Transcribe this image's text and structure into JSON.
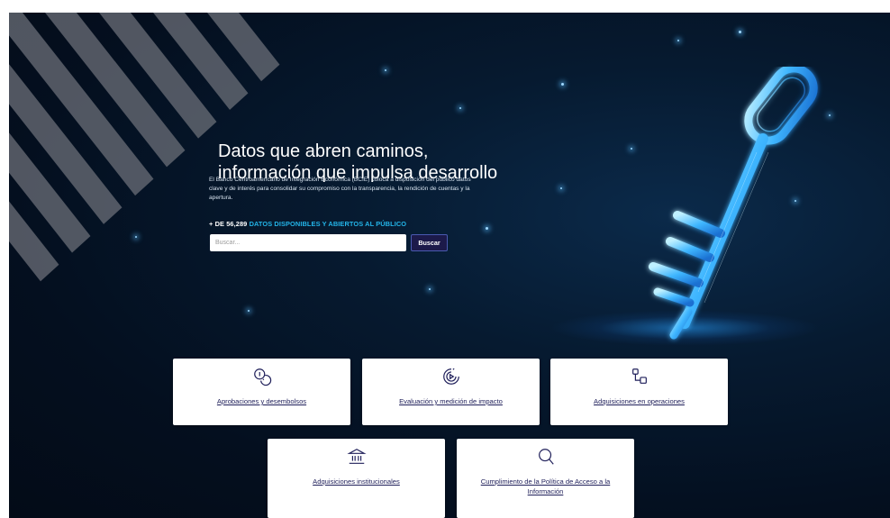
{
  "hero": {
    "headline_line1": "Datos que abren caminos,",
    "headline_line2": "información que impulsa desarrollo",
    "description": "El Banco Centroamericano de Integración Económica (BCIE) coloca a disposición del público datos clave y de interés para consolidar su compromiso con la transparencia, la rendición de cuentas y la apertura.",
    "counter_number": "+ DE 56,289",
    "counter_text": "DATOS DISPONIBLES Y ABIERTOS AL PÚBLICO",
    "search": {
      "placeholder": "Buscar...",
      "button_label": "Buscar"
    }
  },
  "categories": [
    {
      "label": "Aprobaciones y desembolsos",
      "icon": "coins-icon"
    },
    {
      "label": "Evaluación y medición de impacto",
      "icon": "target-play-icon"
    },
    {
      "label": "Adquisiciones en operaciones",
      "icon": "workflow-icon"
    },
    {
      "label": "Adquisiciones institucionales",
      "icon": "bank-building-icon"
    },
    {
      "label": "Cumplimiento de la Política de Acceso a la Información",
      "icon": "search-icon"
    }
  ],
  "colors": {
    "hero_background": "#040f1f",
    "accent_cyan": "#23b4e8",
    "button_background": "#1c1a4a",
    "card_text": "#1f1f5a"
  }
}
